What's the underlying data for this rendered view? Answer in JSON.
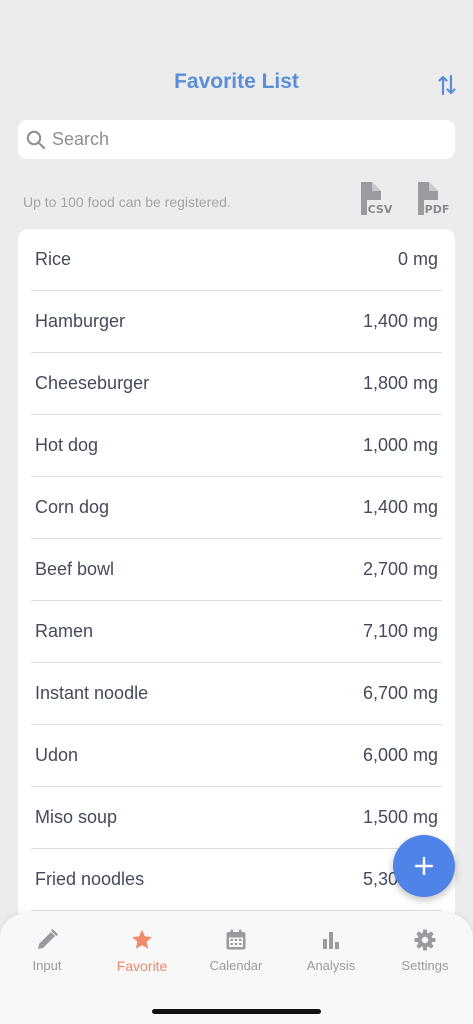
{
  "header": {
    "title": "Favorite List",
    "sort_icon": "sort-arrows-icon"
  },
  "search": {
    "placeholder": "Search",
    "value": ""
  },
  "note": {
    "text": "Up to 100 food can be registered."
  },
  "export": {
    "csv_label": "CSV",
    "pdf_label": "PDF"
  },
  "foods": [
    {
      "name": "Rice",
      "amount": "0 mg"
    },
    {
      "name": "Hamburger",
      "amount": "1,400 mg"
    },
    {
      "name": "Cheeseburger",
      "amount": "1,800 mg"
    },
    {
      "name": "Hot dog",
      "amount": "1,000 mg"
    },
    {
      "name": "Corn dog",
      "amount": "1,400 mg"
    },
    {
      "name": "Beef bowl",
      "amount": "2,700 mg"
    },
    {
      "name": "Ramen",
      "amount": "7,100 mg"
    },
    {
      "name": "Instant noodle",
      "amount": "6,700 mg"
    },
    {
      "name": "Udon",
      "amount": "6,000 mg"
    },
    {
      "name": "Miso soup",
      "amount": "1,500 mg"
    },
    {
      "name": "Fried noodles",
      "amount": "5,300 mg"
    }
  ],
  "tabs": [
    {
      "label": "Input",
      "icon": "pencil-icon"
    },
    {
      "label": "Favorite",
      "icon": "star-icon",
      "active": true
    },
    {
      "label": "Calendar",
      "icon": "calendar-icon"
    },
    {
      "label": "Analysis",
      "icon": "bar-chart-icon"
    },
    {
      "label": "Settings",
      "icon": "gear-icon"
    }
  ],
  "colors": {
    "accent": "#5b8ed8",
    "fab": "#4f83e8",
    "active_tab": "#ef8a6a",
    "inactive_tab": "#9a9aa0"
  }
}
